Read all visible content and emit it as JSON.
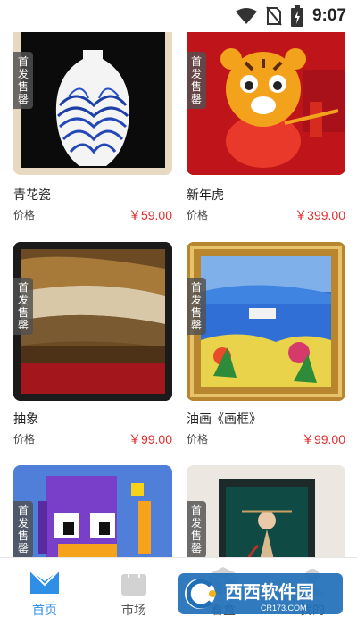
{
  "status_bar": {
    "time": "9:07",
    "icons": [
      "wifi-icon",
      "no-sim-icon",
      "battery-charging-icon"
    ]
  },
  "products": [
    {
      "name": "青花瓷",
      "price_label": "价格",
      "price": "￥59.00",
      "badge": "首发售罄"
    },
    {
      "name": "新年虎",
      "price_label": "价格",
      "price": "￥399.00",
      "badge": "首发售罄"
    },
    {
      "name": "抽象",
      "price_label": "价格",
      "price": "￥99.00",
      "badge": "首发售罄"
    },
    {
      "name": "油画《画框》",
      "price_label": "价格",
      "price": "￥99.00",
      "badge": "首发售罄"
    },
    {
      "name": "",
      "price_label": "",
      "price": "",
      "badge": "首发售罄"
    },
    {
      "name": "",
      "price_label": "",
      "price": "",
      "badge": "首发售罄"
    }
  ],
  "tabbar": {
    "tabs": [
      {
        "label": "首页",
        "icon": "home-icon",
        "active": true
      },
      {
        "label": "市场",
        "icon": "shopping-bag-icon",
        "active": false
      },
      {
        "label": "看盒",
        "icon": "box-icon",
        "active": false
      },
      {
        "label": "我的",
        "icon": "user-icon",
        "active": false
      }
    ],
    "active_color": "#2f8fe6"
  },
  "watermark": {
    "text": "西西软件园",
    "url_text": "CR173.COM"
  },
  "colors": {
    "price": "#e0302f",
    "accent": "#2f8fe6"
  }
}
